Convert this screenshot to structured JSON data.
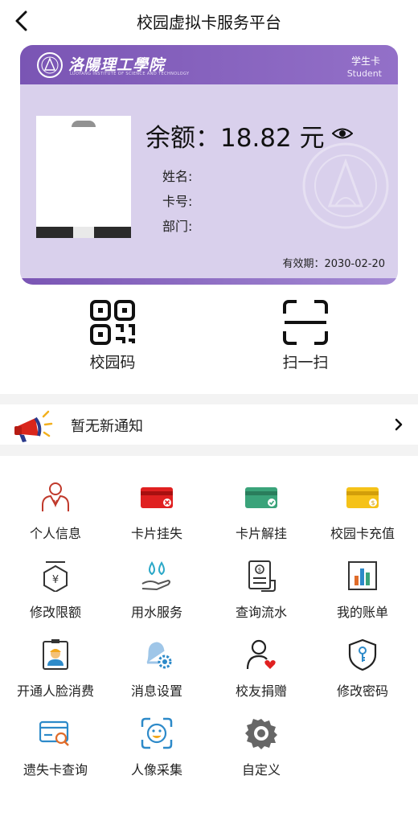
{
  "header": {
    "title": "校园虚拟卡服务平台",
    "back_icon": "chevron-left-icon"
  },
  "card": {
    "school_name": "洛陽理工學院",
    "school_name_en": "LUOYANG INSTITUTE OF SCIENCE AND TECHNOLOGY",
    "card_type": "学生卡",
    "card_type_en": "Student",
    "balance_text": "余额：18.82 元",
    "name_label": "姓名:",
    "card_no_label": "卡号:",
    "dept_label": "部门:",
    "expiry_text": "有效期：2030-02-20",
    "accent_color": "#7a55b4",
    "card_bg_color": "#d9d0ec"
  },
  "quick_actions": [
    {
      "label": "校园码",
      "icon": "qr-code-icon"
    },
    {
      "label": "扫一扫",
      "icon": "scan-icon"
    }
  ],
  "notice": {
    "text": "暂无新通知",
    "icon": "megaphone-icon"
  },
  "services": [
    {
      "label": "个人信息",
      "icon": "person-icon"
    },
    {
      "label": "卡片挂失",
      "icon": "card-lost-icon"
    },
    {
      "label": "卡片解挂",
      "icon": "card-unlock-icon"
    },
    {
      "label": "校园卡充值",
      "icon": "card-recharge-icon"
    },
    {
      "label": "修改限额",
      "icon": "limit-icon"
    },
    {
      "label": "用水服务",
      "icon": "water-icon"
    },
    {
      "label": "查询流水",
      "icon": "statement-icon"
    },
    {
      "label": "我的账单",
      "icon": "bill-chart-icon"
    },
    {
      "label": "开通人脸消费",
      "icon": "face-pay-icon"
    },
    {
      "label": "消息设置",
      "icon": "bell-settings-icon"
    },
    {
      "label": "校友捐赠",
      "icon": "donation-icon"
    },
    {
      "label": "修改密码",
      "icon": "shield-key-icon"
    },
    {
      "label": "遗失卡查询",
      "icon": "card-search-icon"
    },
    {
      "label": "人像采集",
      "icon": "face-scan-icon"
    },
    {
      "label": "自定义",
      "icon": "gear-icon"
    }
  ]
}
